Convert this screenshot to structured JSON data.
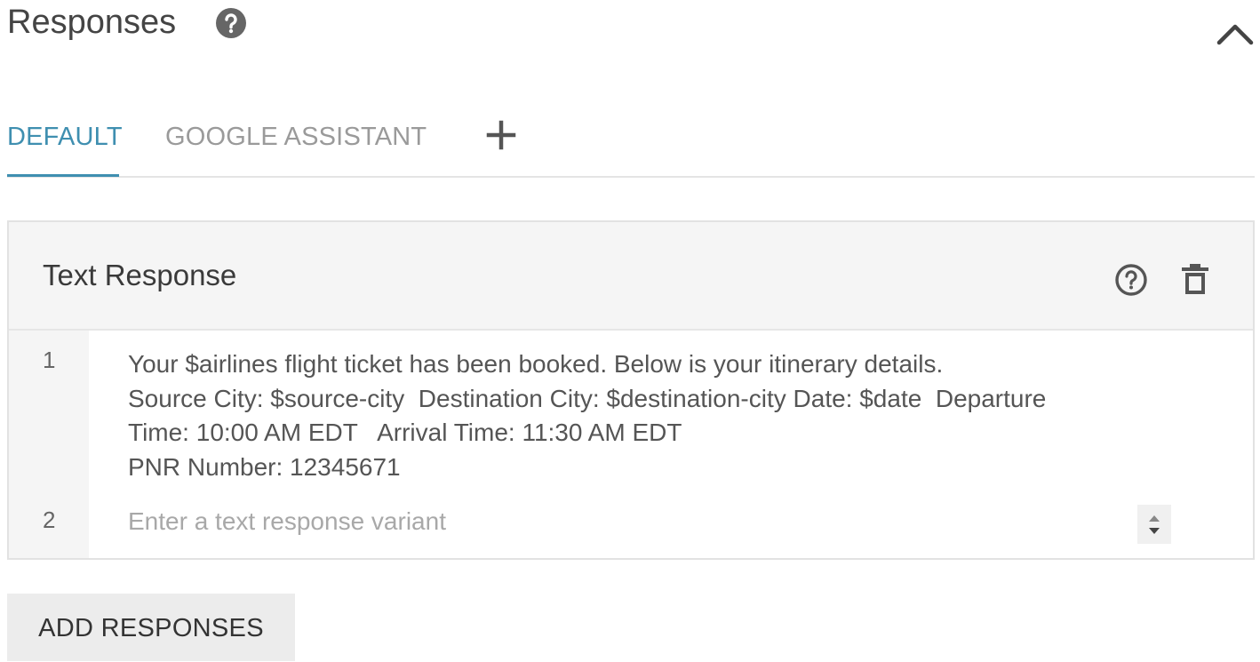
{
  "header": {
    "title": "Responses"
  },
  "tabs": [
    {
      "label": "DEFAULT",
      "active": true
    },
    {
      "label": "GOOGLE ASSISTANT",
      "active": false
    }
  ],
  "card": {
    "title": "Text Response",
    "rows": [
      {
        "number": "1",
        "lines": [
          "Your $airlines flight ticket has been booked. Below is your itinerary details.",
          "Source City: $source-city  Destination City: $destination-city Date: $date  Departure",
          "Time: 10:00 AM EDT   Arrival Time: 11:30 AM EDT",
          "PNR Number: 12345671"
        ]
      },
      {
        "number": "2",
        "value": "",
        "placeholder": "Enter a text response variant"
      }
    ]
  },
  "actions": {
    "add_responses_label": "ADD RESPONSES"
  },
  "icons": {
    "title_help": "help-circle-filled-icon",
    "collapse": "chevron-up-icon",
    "add_tab": "plus-icon",
    "card_help": "help-circle-outline-icon",
    "card_delete": "trash-icon",
    "spinner": "up-down-arrows-icon"
  },
  "colors": {
    "accent": "#3f8fb0",
    "inactive_tab": "#9a9a9a",
    "card_header_bg": "#f5f5f5",
    "button_bg": "#ececec"
  }
}
